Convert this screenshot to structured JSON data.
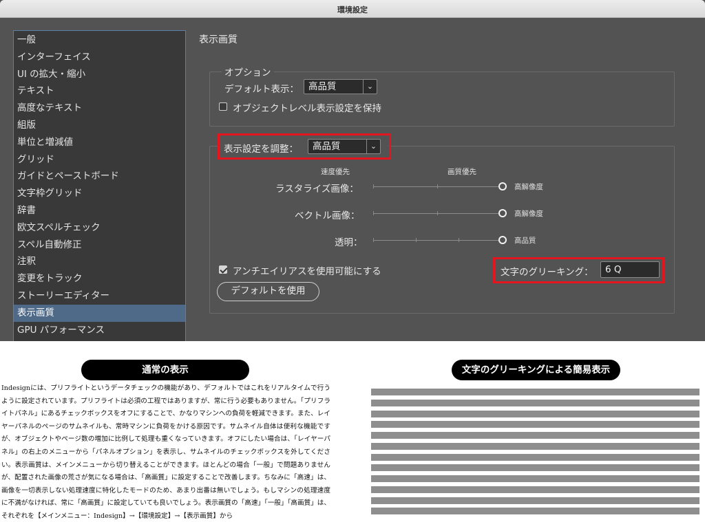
{
  "window": {
    "title": "環境設定"
  },
  "sidebar": {
    "items": [
      "一般",
      "インターフェイス",
      "UI の拡大・縮小",
      "テキスト",
      "高度なテキスト",
      "組版",
      "単位と増減値",
      "グリッド",
      "ガイドとペーストボード",
      "文字枠グリッド",
      "辞書",
      "欧文スペルチェック",
      "スペル自動修正",
      "注釈",
      "変更をトラック",
      "ストーリーエディター",
      "表示画質",
      "GPU パフォーマンス"
    ],
    "selected_index": 16
  },
  "panel": {
    "title": "表示画質",
    "options": {
      "legend": "オプション",
      "default_view_label": "デフォルト表示：",
      "default_view_value": "高品質",
      "object_level_label": "オブジェクトレベル表示設定を保持",
      "object_level_checked": false
    },
    "adjust": {
      "label": "表示設定を調整：",
      "value": "高品質",
      "speed_label": "速度優先",
      "quality_label": "画質優先",
      "rows": [
        {
          "label": "ラスタライズ画像：",
          "value_label": "高解像度",
          "level": 1.0
        },
        {
          "label": "ベクトル画像：",
          "value_label": "高解像度",
          "level": 1.0
        },
        {
          "label": "透明：",
          "value_label": "高品質",
          "level": 1.0
        }
      ],
      "antialias_label": "アンチエイリアスを使用可能にする",
      "antialias_checked": true,
      "greek_label": "文字のグリーキング：",
      "greek_value": "6 Q",
      "default_button": "デフォルトを使用"
    }
  },
  "bottom": {
    "left_header": "通常の表示",
    "right_header": "文字のグリーキングによる簡易表示",
    "body": "Indesignには、プリフライトというデータチェックの機能があり、デフォルトではこれをリアルタイムで行うように設定されています。プリフライトは必須の工程ではありますが、常に行う必要もありません。「プリフライトパネル」にあるチェックボックスをオフにすることで、かなりマシンへの負荷を軽減できます。また、レイヤーパネルのページのサムネイルも、常時マシンに負荷をかける原因です。サムネイル自体は便利な機能ですが、オブジェクトやページ数の増加に比例して処理も重くなっていきます。オフにしたい場合は、「レイヤーパネル」の右上のメニューから「パネルオプション」を表示し、サムネイルのチェックボックスを外してください。表示画質は、メインメニューから切り替えることができます。ほとんどの場合「一般」で問題ありませんが、配置された画像の荒さが気になる場合は、「高画質」に設定することで改善します。ちなみに「高速」は、画像を一切表示しない処理速度に特化したモードのため、あまり出番は無いでしょう。もしマシンの処理速度に不満がなければ、常に「高画質」に設定していても良いでしょう。表示画質の「高速」「一般」「高画質」は、それぞれを【メインメニュー：Indesign】→【環境設定】→【表示画質】から"
  },
  "colors": {
    "highlight": "#e4151f",
    "window_bg": "#535353",
    "selected": "#4f6a88"
  }
}
